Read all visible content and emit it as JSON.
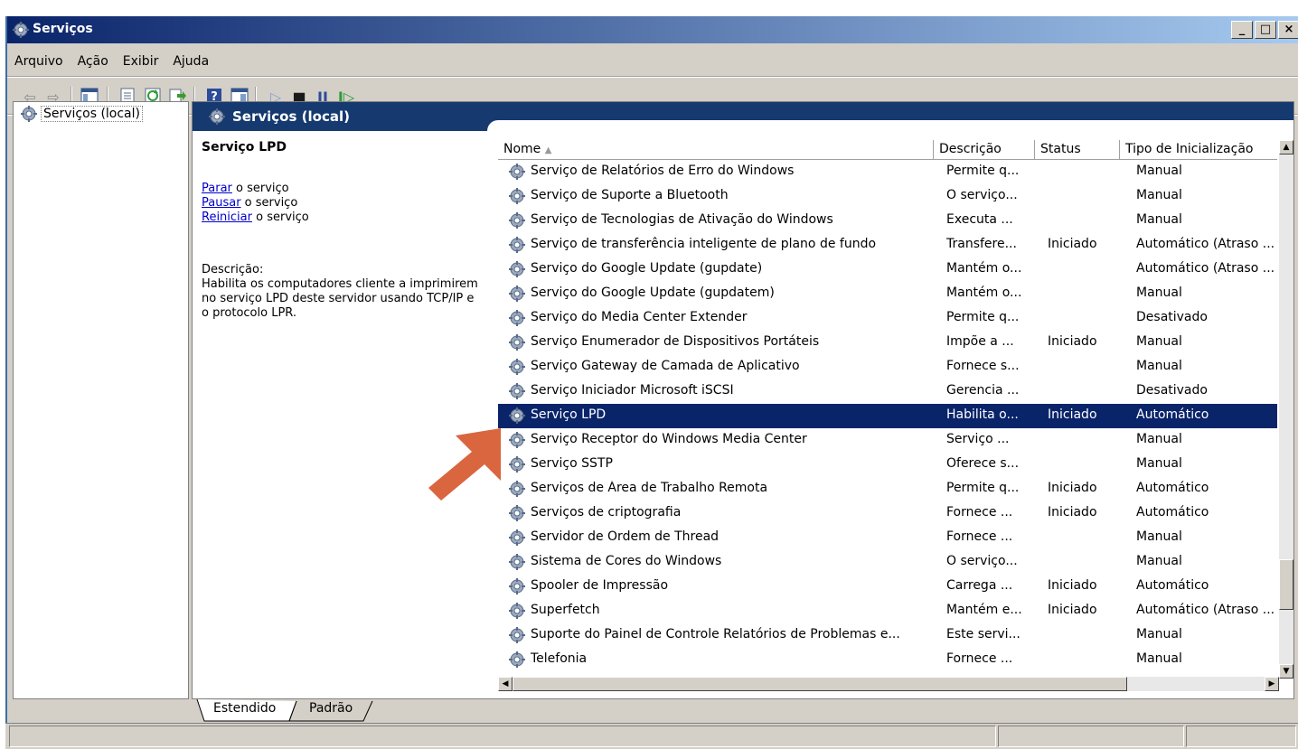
{
  "window": {
    "title": "Serviços",
    "buttons": [
      "_",
      "□",
      "×"
    ]
  },
  "menu": [
    "Arquivo",
    "Ação",
    "Exibir",
    "Ajuda"
  ],
  "tree": {
    "root_label": "Serviços (local)"
  },
  "panel_header": "Serviços (local)",
  "selected_service": {
    "name": "Serviço LPD",
    "action_stop_link": "Parar",
    "action_stop_rest": " o serviço",
    "action_pause_link": "Pausar",
    "action_pause_rest": " o serviço",
    "action_restart_link": "Reiniciar",
    "action_restart_rest": " o serviço",
    "description_label": "Descrição:",
    "description_text": "Habilita os computadores cliente a imprimirem no serviço LPD deste servidor usando TCP/IP e o protocolo LPR."
  },
  "columns": {
    "name": "Nome",
    "desc": "Descrição",
    "status": "Status",
    "type": "Tipo de Inicialização"
  },
  "rows": [
    {
      "name": "Serviço de Relatórios de Erro do Windows",
      "desc": "Permite q...",
      "status": "",
      "type": "Manual"
    },
    {
      "name": "Serviço de Suporte a Bluetooth",
      "desc": "O serviço...",
      "status": "",
      "type": "Manual"
    },
    {
      "name": "Serviço de Tecnologias de Ativação do Windows",
      "desc": "Executa ...",
      "status": "",
      "type": "Manual"
    },
    {
      "name": "Serviço de transferência inteligente de plano de fundo",
      "desc": "Transfere...",
      "status": "Iniciado",
      "type": "Automático (Atraso ..."
    },
    {
      "name": "Serviço do Google Update (gupdate)",
      "desc": "Mantém o...",
      "status": "",
      "type": "Automático (Atraso ..."
    },
    {
      "name": "Serviço do Google Update (gupdatem)",
      "desc": "Mantém o...",
      "status": "",
      "type": "Manual"
    },
    {
      "name": "Serviço do Media Center Extender",
      "desc": "Permite q...",
      "status": "",
      "type": "Desativado"
    },
    {
      "name": "Serviço Enumerador de Dispositivos Portáteis",
      "desc": "Impõe a ...",
      "status": "Iniciado",
      "type": "Manual"
    },
    {
      "name": "Serviço Gateway de Camada de Aplicativo",
      "desc": "Fornece s...",
      "status": "",
      "type": "Manual"
    },
    {
      "name": "Serviço Iniciador Microsoft iSCSI",
      "desc": "Gerencia ...",
      "status": "",
      "type": "Desativado"
    },
    {
      "name": "Serviço LPD",
      "desc": "Habilita o...",
      "status": "Iniciado",
      "type": "Automático"
    },
    {
      "name": "Serviço Receptor do Windows Media Center",
      "desc": "Serviço ...",
      "status": "",
      "type": "Manual"
    },
    {
      "name": "Serviço SSTP",
      "desc": "Oferece s...",
      "status": "",
      "type": "Manual"
    },
    {
      "name": "Serviços de Área de Trabalho Remota",
      "desc": "Permite q...",
      "status": "Iniciado",
      "type": "Automático"
    },
    {
      "name": "Serviços de criptografia",
      "desc": "Fornece ...",
      "status": "Iniciado",
      "type": "Automático"
    },
    {
      "name": "Servidor de Ordem de Thread",
      "desc": "Fornece ...",
      "status": "",
      "type": "Manual"
    },
    {
      "name": "Sistema de Cores do Windows",
      "desc": "O serviço...",
      "status": "",
      "type": "Manual"
    },
    {
      "name": "Spooler de Impressão",
      "desc": "Carrega ...",
      "status": "Iniciado",
      "type": "Automático"
    },
    {
      "name": "Superfetch",
      "desc": "Mantém e...",
      "status": "Iniciado",
      "type": "Automático (Atraso ..."
    },
    {
      "name": "Suporte do Painel de Controle Relatórios de Problemas e...",
      "desc": "Este servi...",
      "status": "",
      "type": "Manual"
    },
    {
      "name": "Telefonia",
      "desc": "Fornece ...",
      "status": "",
      "type": "Manual"
    }
  ],
  "selected_row_index": 10,
  "tabs": [
    "Estendido",
    "Padrão"
  ],
  "colors": {
    "title_start": "#0a246a",
    "title_end": "#a6caf0",
    "panel_header": "#163a6f",
    "selection": "#0a246a",
    "arrow": "#d9663f",
    "link": "#0000cc"
  },
  "icons": [
    "services-gear-icon",
    "back-icon",
    "forward-icon",
    "show-hide-tree-icon",
    "properties-icon",
    "refresh-icon",
    "export-icon",
    "help-icon",
    "mmc-view-icon",
    "play-icon",
    "stop-icon",
    "pause-icon",
    "resume-icon"
  ]
}
